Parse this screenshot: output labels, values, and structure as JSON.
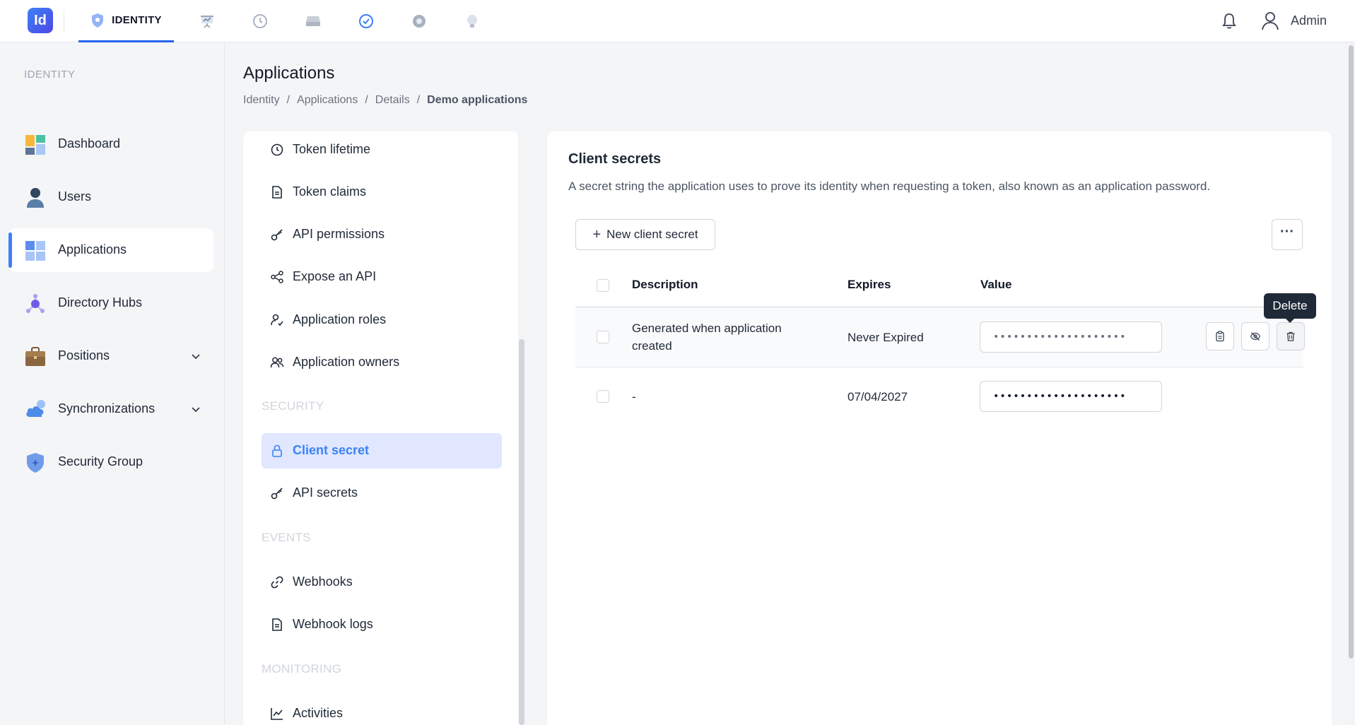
{
  "topbar": {
    "logo_text": "Id",
    "active_tab_label": "IDENTITY",
    "app_tabs": [
      "shield-icon",
      "presentation-icon",
      "history-icon",
      "drive-icon",
      "badge-check-icon",
      "gear-icon",
      "lightbulb-icon"
    ],
    "user_label": "Admin"
  },
  "sidebar": {
    "heading": "IDENTITY",
    "items": [
      {
        "label": "Dashboard",
        "icon": "dashboard-icon"
      },
      {
        "label": "Users",
        "icon": "user-icon"
      },
      {
        "label": "Applications",
        "icon": "applications-icon",
        "active": true
      },
      {
        "label": "Directory Hubs",
        "icon": "hub-icon"
      },
      {
        "label": "Positions",
        "icon": "briefcase-icon",
        "expandable": true
      },
      {
        "label": "Synchronizations",
        "icon": "cloud-sync-icon",
        "expandable": true
      },
      {
        "label": "Security Group",
        "icon": "shield-icon"
      }
    ]
  },
  "page": {
    "title": "Applications",
    "breadcrumb": [
      "Identity",
      "Applications",
      "Details",
      "Demo applications"
    ]
  },
  "nav": {
    "items": [
      {
        "label": "Token lifetime",
        "icon": "clock-icon"
      },
      {
        "label": "Token claims",
        "icon": "document-icon"
      },
      {
        "label": "API permissions",
        "icon": "key-icon"
      },
      {
        "label": "Expose an API",
        "icon": "share-icon"
      },
      {
        "label": "Application roles",
        "icon": "user-role-icon"
      },
      {
        "label": "Application owners",
        "icon": "users-icon"
      }
    ],
    "security_heading": "SECURITY",
    "security_items": [
      {
        "label": "Client secret",
        "icon": "lock-icon",
        "active": true
      },
      {
        "label": "API secrets",
        "icon": "key-icon"
      }
    ],
    "events_heading": "EVENTS",
    "events_items": [
      {
        "label": "Webhooks",
        "icon": "link-icon"
      },
      {
        "label": "Webhook logs",
        "icon": "document-icon"
      }
    ],
    "monitoring_heading": "MONITORING",
    "monitoring_items": [
      {
        "label": "Activities",
        "icon": "chart-line-icon"
      }
    ]
  },
  "client_secrets": {
    "title": "Client secrets",
    "description": "A secret string the application uses to prove its identity when requesting a token, also known as an application password.",
    "new_button": "New client secret",
    "more_button": "···",
    "columns": {
      "description": "Description",
      "expires": "Expires",
      "value": "Value"
    },
    "rows": [
      {
        "description": "Generated when application created",
        "expires": "Never Expired",
        "value": "••••••••••••••••••••"
      },
      {
        "description": "-",
        "expires": "07/04/2027",
        "value": "••••••••••••••••••••"
      }
    ],
    "tooltip": "Delete"
  }
}
